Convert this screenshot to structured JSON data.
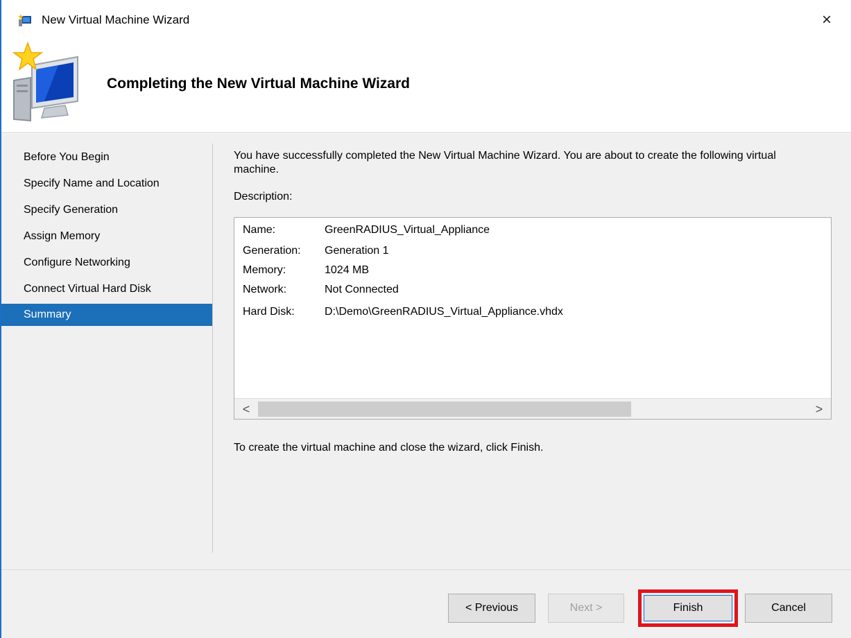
{
  "window": {
    "title": "New Virtual Machine Wizard",
    "close_glyph": "×"
  },
  "header": {
    "title": "Completing the New Virtual Machine Wizard"
  },
  "sidebar": {
    "items": [
      {
        "label": "Before You Begin",
        "active": false
      },
      {
        "label": "Specify Name and Location",
        "active": false
      },
      {
        "label": "Specify Generation",
        "active": false
      },
      {
        "label": "Assign Memory",
        "active": false
      },
      {
        "label": "Configure Networking",
        "active": false
      },
      {
        "label": "Connect Virtual Hard Disk",
        "active": false
      },
      {
        "label": "Summary",
        "active": true
      }
    ]
  },
  "main": {
    "intro": "You have successfully completed the New Virtual Machine Wizard. You are about to create the following virtual machine.",
    "description_label": "Description:",
    "description": [
      {
        "key": "Name:",
        "value": "GreenRADIUS_Virtual_Appliance"
      },
      {
        "key": "Generation:",
        "value": "Generation 1"
      },
      {
        "key": "Memory:",
        "value": "1024 MB"
      },
      {
        "key": "Network:",
        "value": "Not Connected"
      },
      {
        "key": "Hard Disk:",
        "value": "D:\\Demo\\GreenRADIUS_Virtual_Appliance.vhdx"
      }
    ],
    "scroll_left": "<",
    "scroll_right": ">",
    "finish_note": "To create the virtual machine and close the wizard, click Finish."
  },
  "footer": {
    "previous_label": "< Previous",
    "next_label": "Next >",
    "finish_label": "Finish",
    "cancel_label": "Cancel"
  },
  "colors": {
    "accent": "#1c6fb9",
    "highlight": "#e0141e"
  }
}
